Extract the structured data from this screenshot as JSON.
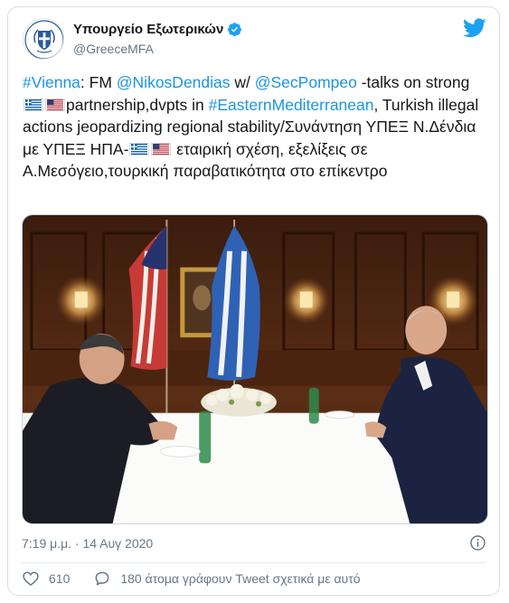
{
  "account": {
    "display_name": "Υπουργείο Εξωτερικών",
    "handle": "@GreeceMFA",
    "avatar_icon": "greek-coat-of-arms",
    "verified_icon": "verified-badge-icon"
  },
  "tweet": {
    "t1": "#Vienna",
    "t2": ": FM ",
    "t3": "@NikosDendias",
    "t4": " w/ ",
    "t5": "@SecPompeo",
    "t6": " -talks on strong ",
    "t7": "partnership,dvpts in ",
    "t8": "#EasternMediterranean",
    "t9": ", Turkish illegal actions jeopardizing regional stability/Συνάντηση ΥΠΕΞ Ν.Δένδια με ΥΠΕΞ ΗΠΑ-",
    "t10": " εταιρική σχέση, εξελίξεις σε Α.Μεσόγειο,τουρκική παραβατικότητα στο επίκεντρο"
  },
  "photo": {
    "alt_icon": "meeting-photo"
  },
  "meta": {
    "timestamp": "7:19 μ.μ. · 14 Αυγ 2020"
  },
  "actions": {
    "likes": "610",
    "replies_text": "180 άτομα γράφουν Tweet σχετικά με αυτό"
  },
  "colors": {
    "link": "#1b95e0",
    "text": "#14171a",
    "secondary": "#657786",
    "twitter_blue": "#1da1f2"
  }
}
